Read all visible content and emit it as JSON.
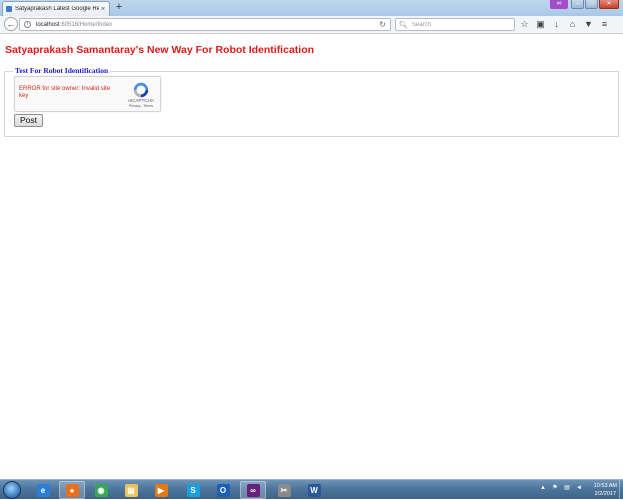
{
  "browser": {
    "tab_title": "Satyaprakash Latest Google Re...",
    "tab_close": "×",
    "new_tab": "+",
    "url_host": "localhost",
    "url_path": ":60516/Home/Index",
    "search_placeholder": "Search",
    "persona_glyph": "∞",
    "window_buttons": {
      "minimize": "–",
      "maximize": "□",
      "close": "✕"
    },
    "toolbar_icons": [
      "star-icon",
      "reading-list-icon",
      "download-icon",
      "home-icon",
      "pocket-icon",
      "menu-icon"
    ]
  },
  "page": {
    "title": "Satyaprakash Samantaray's New Way For Robot Identification",
    "legend": "Test For Robot Identification",
    "recaptcha": {
      "error": "ERROR for site owner: Invalid site key",
      "brand": "reCAPTCHA",
      "links": "Privacy - Terms"
    },
    "post_button": "Post"
  },
  "taskbar": {
    "apps": [
      {
        "name": "internet-explorer",
        "glyph": "e",
        "color": "#2a7fd4",
        "active": false
      },
      {
        "name": "firefox",
        "glyph": "●",
        "color": "#e8701a",
        "active": true
      },
      {
        "name": "chrome",
        "glyph": "◉",
        "color": "#3aa757",
        "active": false
      },
      {
        "name": "file-explorer",
        "glyph": "▤",
        "color": "#e8c45a",
        "active": false
      },
      {
        "name": "media-player",
        "glyph": "▶",
        "color": "#e07b1a",
        "active": false
      },
      {
        "name": "skype",
        "glyph": "S",
        "color": "#1a9fdb",
        "active": false
      },
      {
        "name": "outlook",
        "glyph": "O",
        "color": "#1c5fb4",
        "active": false
      },
      {
        "name": "visual-studio",
        "glyph": "∞",
        "color": "#68217a",
        "active": true
      },
      {
        "name": "tools",
        "glyph": "✂",
        "color": "#8a8a8a",
        "active": false
      },
      {
        "name": "word",
        "glyph": "W",
        "color": "#2b579a",
        "active": false
      }
    ],
    "time": "10:53 AM",
    "date": "2/2/2017"
  }
}
